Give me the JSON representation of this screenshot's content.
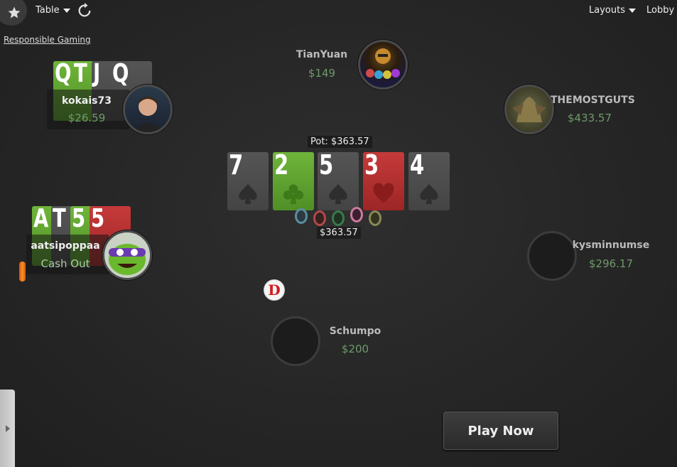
{
  "toolbar": {
    "table_label": "Table",
    "layouts_label": "Layouts",
    "lobby_label": "Lobby",
    "responsible_gaming": "Responsible Gaming"
  },
  "pot": {
    "label": "Pot: $363.57",
    "chips_amount": "$363.57"
  },
  "board": [
    {
      "rank": "7",
      "suit": "spade"
    },
    {
      "rank": "2",
      "suit": "club"
    },
    {
      "rank": "5",
      "suit": "spade"
    },
    {
      "rank": "3",
      "suit": "heart"
    },
    {
      "rank": "4",
      "suit": "spade"
    }
  ],
  "players": {
    "tianyuan": {
      "name": "TianYuan",
      "stack": "$149"
    },
    "kokais73": {
      "name": "kokais73",
      "stack": "$26.59",
      "cards": [
        "Q",
        "T",
        "J",
        "Q"
      ]
    },
    "themostguts": {
      "name": "THEMOSTGUTS",
      "stack": "$433.57"
    },
    "aatsipoppaa": {
      "name": "aatsipoppaa",
      "stack": "Cash Out",
      "cards": [
        "A",
        "T",
        "5",
        "5"
      ]
    },
    "kysminnumse": {
      "name": "kysminnumse",
      "stack": "$296.17"
    },
    "schumpo": {
      "name": "Schumpo",
      "stack": "$200"
    }
  },
  "dealer_button": "D",
  "play_now_label": "Play Now",
  "colors": {
    "club": "#5fa832",
    "heart": "#b83030",
    "spade": "#4a4a4a",
    "stack_green": "#6e9a6a"
  }
}
